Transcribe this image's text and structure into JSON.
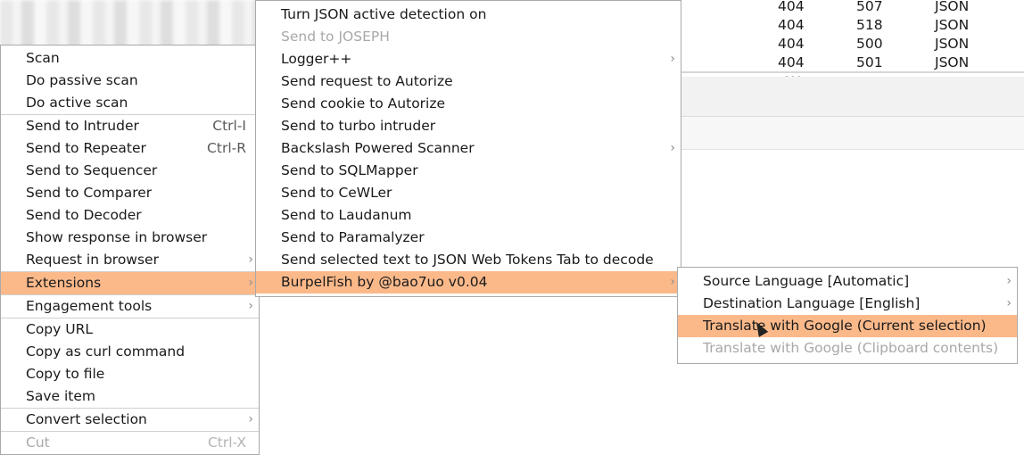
{
  "background_table": {
    "rows": [
      {
        "status": "404",
        "length": "507",
        "type": "JSON"
      },
      {
        "status": "404",
        "length": "518",
        "type": "JSON"
      },
      {
        "status": "404",
        "length": "500",
        "type": "JSON"
      },
      {
        "status": "404",
        "length": "501",
        "type": "JSON"
      }
    ],
    "grip": "•••"
  },
  "context_menu": {
    "items": [
      {
        "label": "Scan"
      },
      {
        "label": "Do passive scan"
      },
      {
        "label": "Do active scan"
      },
      {
        "label": "Send to Intruder",
        "shortcut": "Ctrl-I"
      },
      {
        "label": "Send to Repeater",
        "shortcut": "Ctrl-R"
      },
      {
        "label": "Send to Sequencer"
      },
      {
        "label": "Send to Comparer"
      },
      {
        "label": "Send to Decoder"
      },
      {
        "label": "Show response in browser"
      },
      {
        "label": "Request in browser"
      },
      {
        "label": "Extensions"
      },
      {
        "label": "Engagement tools"
      },
      {
        "label": "Copy URL"
      },
      {
        "label": "Copy as curl command"
      },
      {
        "label": "Copy to file"
      },
      {
        "label": "Save item"
      },
      {
        "label": "Convert selection"
      },
      {
        "label": "Cut",
        "shortcut": "Ctrl-X"
      }
    ]
  },
  "extensions_menu": {
    "items": [
      {
        "label": "Turn JSON active detection on"
      },
      {
        "label": "Send to JOSEPH"
      },
      {
        "label": "Logger++"
      },
      {
        "label": "Send request to Autorize"
      },
      {
        "label": "Send cookie to Autorize"
      },
      {
        "label": "Send to turbo intruder"
      },
      {
        "label": "Backslash Powered Scanner"
      },
      {
        "label": "Send to SQLMapper"
      },
      {
        "label": "Send to CeWLer"
      },
      {
        "label": "Send to Laudanum"
      },
      {
        "label": "Send to Paramalyzer"
      },
      {
        "label": "Send selected text to JSON Web Tokens Tab to decode"
      },
      {
        "label": "BurpelFish by @bao7uo v0.04"
      }
    ]
  },
  "burpelfish_menu": {
    "items": [
      {
        "label": "Source Language [Automatic]"
      },
      {
        "label": "Destination Language [English]"
      },
      {
        "label": "Translate with Google (Current selection)"
      },
      {
        "label": "Translate with Google (Clipboard contents)"
      }
    ]
  },
  "arrow_glyph": "›",
  "colors": {
    "highlight": "#fbb98a",
    "disabled_text": "#a8a8a8"
  }
}
